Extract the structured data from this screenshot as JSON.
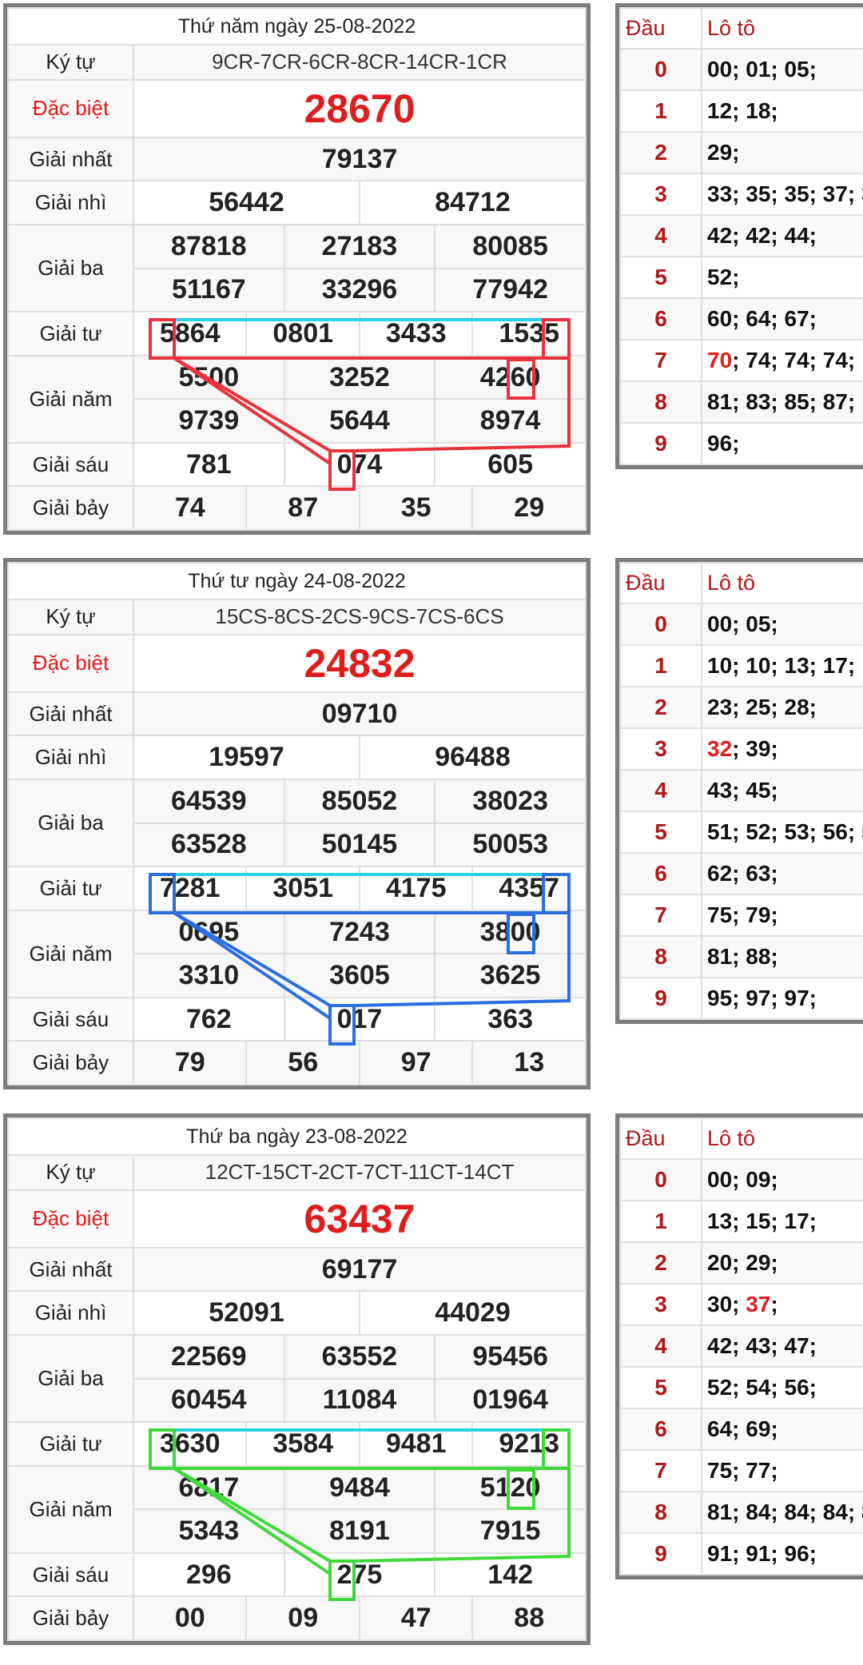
{
  "labels": {
    "kytu": "Ký tự",
    "db": "Đặc biệt",
    "g1": "Giải nhất",
    "g2": "Giải nhì",
    "g3": "Giải ba",
    "g4": "Giải tư",
    "g5": "Giải năm",
    "g6": "Giải sáu",
    "g7": "Giải bảy",
    "dau": "Đầu",
    "loto": "Lô tô"
  },
  "days": [
    {
      "title": "Thứ năm ngày 25-08-2022",
      "kytu": "9CR-7CR-6CR-8CR-14CR-1CR",
      "db": "28670",
      "g1": "79137",
      "g2": [
        "56442",
        "84712"
      ],
      "g3": [
        "87818",
        "27183",
        "80085",
        "51167",
        "33296",
        "77942"
      ],
      "g4": [
        "5864",
        "0801",
        "3433",
        "1535"
      ],
      "g5": [
        "5500",
        "3252",
        "4260",
        "9739",
        "5644",
        "8974"
      ],
      "g6": [
        "781",
        "074",
        "605"
      ],
      "g7": [
        "74",
        "87",
        "35",
        "29"
      ],
      "loto": [
        {
          "d": "0",
          "pre": "",
          "hl": "",
          "post": "00; 01; 05;"
        },
        {
          "d": "1",
          "pre": "",
          "hl": "",
          "post": "12; 18;"
        },
        {
          "d": "2",
          "pre": "",
          "hl": "",
          "post": "29;"
        },
        {
          "d": "3",
          "pre": "",
          "hl": "",
          "post": "33; 35; 35; 37; 3"
        },
        {
          "d": "4",
          "pre": "",
          "hl": "",
          "post": "42; 42; 44;"
        },
        {
          "d": "5",
          "pre": "",
          "hl": "",
          "post": "52;"
        },
        {
          "d": "6",
          "pre": "",
          "hl": "",
          "post": "60; 64; 67;"
        },
        {
          "d": "7",
          "pre": "",
          "hl": "70",
          "post": "; 74; 74; 74;"
        },
        {
          "d": "8",
          "pre": "",
          "hl": "",
          "post": "81; 83; 85; 87;"
        },
        {
          "d": "9",
          "pre": "",
          "hl": "",
          "post": "96;"
        }
      ],
      "color": "#e8323c"
    },
    {
      "title": "Thứ tư ngày 24-08-2022",
      "kytu": "15CS-8CS-2CS-9CS-7CS-6CS",
      "db": "24832",
      "g1": "09710",
      "g2": [
        "19597",
        "96488"
      ],
      "g3": [
        "64539",
        "85052",
        "38023",
        "63528",
        "50145",
        "50053"
      ],
      "g4": [
        "7281",
        "3051",
        "4175",
        "4357"
      ],
      "g5": [
        "0695",
        "7243",
        "3800",
        "3310",
        "3605",
        "3625"
      ],
      "g6": [
        "762",
        "017",
        "363"
      ],
      "g7": [
        "79",
        "56",
        "97",
        "13"
      ],
      "loto": [
        {
          "d": "0",
          "pre": "",
          "hl": "",
          "post": "00; 05;"
        },
        {
          "d": "1",
          "pre": "",
          "hl": "",
          "post": "10; 10; 13; 17;"
        },
        {
          "d": "2",
          "pre": "",
          "hl": "",
          "post": "23; 25; 28;"
        },
        {
          "d": "3",
          "pre": "",
          "hl": "32",
          "post": "; 39;"
        },
        {
          "d": "4",
          "pre": "",
          "hl": "",
          "post": "43; 45;"
        },
        {
          "d": "5",
          "pre": "",
          "hl": "",
          "post": "51; 52; 53; 56; 5"
        },
        {
          "d": "6",
          "pre": "",
          "hl": "",
          "post": "62; 63;"
        },
        {
          "d": "7",
          "pre": "",
          "hl": "",
          "post": "75; 79;"
        },
        {
          "d": "8",
          "pre": "",
          "hl": "",
          "post": "81; 88;"
        },
        {
          "d": "9",
          "pre": "",
          "hl": "",
          "post": "95; 97; 97;"
        }
      ],
      "color": "#2a6ee0"
    },
    {
      "title": "Thứ ba ngày 23-08-2022",
      "kytu": "12CT-15CT-2CT-7CT-11CT-14CT",
      "db": "63437",
      "g1": "69177",
      "g2": [
        "52091",
        "44029"
      ],
      "g3": [
        "22569",
        "63552",
        "95456",
        "60454",
        "11084",
        "01964"
      ],
      "g4": [
        "3630",
        "3584",
        "9481",
        "9213"
      ],
      "g5": [
        "6817",
        "9484",
        "5120",
        "5343",
        "8191",
        "7915"
      ],
      "g6": [
        "296",
        "275",
        "142"
      ],
      "g7": [
        "00",
        "09",
        "47",
        "88"
      ],
      "loto": [
        {
          "d": "0",
          "pre": "",
          "hl": "",
          "post": "00; 09;"
        },
        {
          "d": "1",
          "pre": "",
          "hl": "",
          "post": "13; 15; 17;"
        },
        {
          "d": "2",
          "pre": "",
          "hl": "",
          "post": "20; 29;"
        },
        {
          "d": "3",
          "pre": "30; ",
          "hl": "37",
          "post": ";"
        },
        {
          "d": "4",
          "pre": "",
          "hl": "",
          "post": "42; 43; 47;"
        },
        {
          "d": "5",
          "pre": "",
          "hl": "",
          "post": "52; 54; 56;"
        },
        {
          "d": "6",
          "pre": "",
          "hl": "",
          "post": "64; 69;"
        },
        {
          "d": "7",
          "pre": "",
          "hl": "",
          "post": "75; 77;"
        },
        {
          "d": "8",
          "pre": "",
          "hl": "",
          "post": "81; 84; 84; 84; 8"
        },
        {
          "d": "9",
          "pre": "",
          "hl": "",
          "post": "91; 91; 96;"
        }
      ],
      "color": "#3fd93a"
    }
  ]
}
